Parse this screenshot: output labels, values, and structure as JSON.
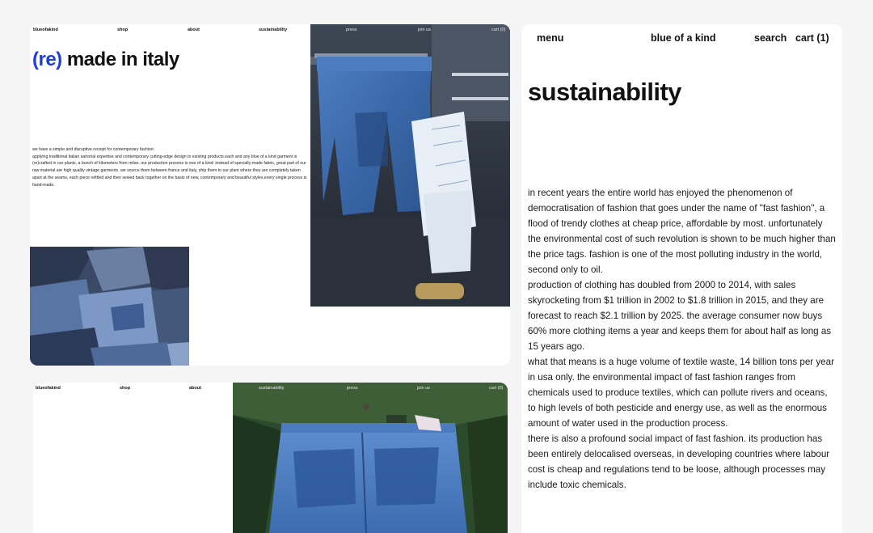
{
  "card1": {
    "nav": {
      "logo": "blueofakind",
      "shop": "shop",
      "about": "about",
      "sustainability": "sustainability",
      "press": "press",
      "join_us": "join us",
      "cart": "cart (0)"
    },
    "title_accent": "(re)",
    "title_rest": " made in italy",
    "paragraphs": [
      "we have a simple and disruptive receipt for contemporary fashion:",
      "applying traditional italian sartorial expertise and contemporary cutting-edge design to existing products.each and any blue of a kind garment is (re)crafted in our plants, a bunch of kilometers from milan. our production process is one of a kind: instead of specially-made fabric, great part of our raw material are high quality vintage garments. we source them between france and italy, ship them to our plant where they are completely taken apart at the seams, each piece refitted and then sewed back together on the basis of new, contemporary and beautiful styles.every single process is hand-made."
    ]
  },
  "card2": {
    "nav": {
      "logo": "blueofakind",
      "shop": "shop",
      "about": "about",
      "sustainability": "sustainability",
      "press": "press",
      "join_us": "join us",
      "cart": "cart (0)"
    }
  },
  "card3": {
    "nav": {
      "menu": "menu",
      "brand": "blue of a kind",
      "search": "search",
      "cart": "cart (1)"
    },
    "title": "sustainability",
    "paragraphs": [
      "in recent years the entire world has enjoyed the phenomenon of democratisation of fashion that goes under the name of \"fast fashion\", a flood of trendy clothes at cheap price, affordable by most. unfortunately the environmental cost of such revolution is shown to be much higher than the price tags. fashion is one of the most polluting industry in the world, second only to oil.",
      "production of clothing has doubled from 2000 to 2014, with sales skyrocketing from $1 trillion in 2002 to $1.8 trillion in 2015, and they are forecast to reach $2.1 trillion by 2025. the average consumer now buys 60% more clothing items a year and keeps them for about half as long as 15 years ago.",
      "what that means is a huge volume of textile waste, 14 billion tons per year in usa only. the environmental impact of fast fashion ranges from chemicals used to produce textiles, which can pollute rivers and oceans, to high levels of both pesticide and energy use, as well as the enormous amount of water used in the production process.",
      "there is also a profound social impact of fast fashion. its production has been entirely delocalised overseas, in developing countries where labour cost is cheap and regulations tend to be loose, although processes may include toxic chemicals."
    ]
  }
}
